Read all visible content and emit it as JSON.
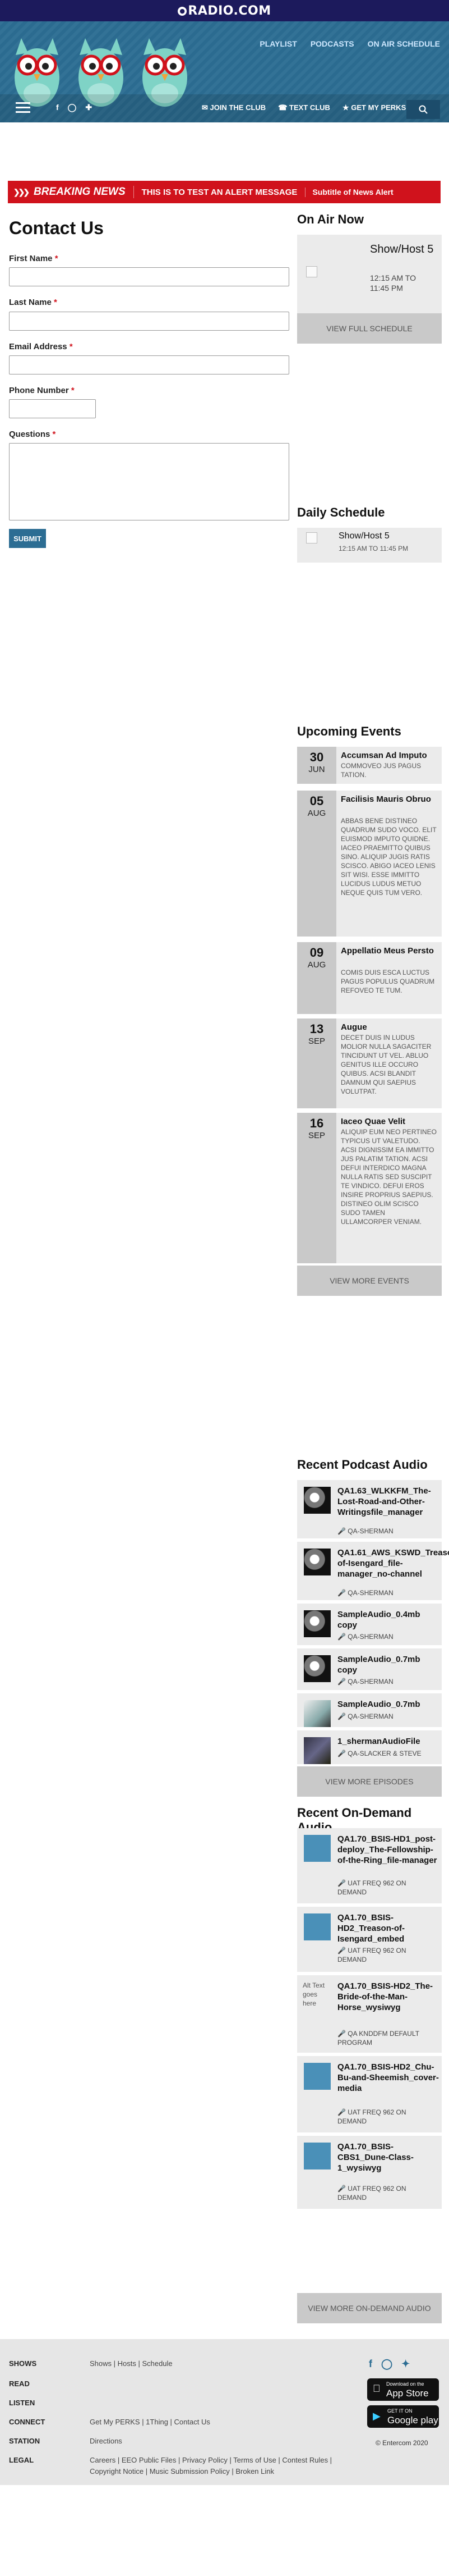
{
  "brand": {
    "logo": "RADIO.COM",
    "logo_mark": "●"
  },
  "header": {
    "nav_top": [
      "PLAYLIST",
      "PODCASTS",
      "ON AIR SCHEDULE"
    ],
    "perks": [
      "JOIN THE CLUB",
      "TEXT CLUB",
      "GET MY PERKS"
    ]
  },
  "alert": {
    "label": "BREAKING NEWS",
    "message": "THIS IS TO TEST AN ALERT MESSAGE",
    "subtitle": "Subtitle of News Alert"
  },
  "form": {
    "title": "Contact Us",
    "fields": [
      {
        "label": "First Name",
        "required": "*"
      },
      {
        "label": "Last Name",
        "required": "*"
      },
      {
        "label": "Email Address",
        "required": "*"
      },
      {
        "label": "Phone Number",
        "required": "*"
      },
      {
        "label": "Questions",
        "required": "*"
      }
    ],
    "submit": "SUBMIT"
  },
  "on_air": {
    "heading": "On Air Now",
    "show": "Show/Host 5",
    "time": "12:15 AM TO 11:45 PM",
    "button": "VIEW FULL SCHEDULE"
  },
  "daily": {
    "heading": "Daily Schedule",
    "show": "Show/Host 5",
    "time": "12:15 AM TO 11:45 PM"
  },
  "events": {
    "heading": "Upcoming Events",
    "items": [
      {
        "day": "30",
        "month": "JUN",
        "title": "Accumsan Ad Imputo",
        "desc": "COMMOVEO JUS PAGUS TATION."
      },
      {
        "day": "05",
        "month": "AUG",
        "title": "Facilisis Mauris Obruo",
        "desc": "ABBAS BENE DISTINEO QUADRUM SUDO VOCO. ELIT EUISMOD IMPUTO QUIDNE. IACEO PRAEMITTO QUIBUS SINO. ALIQUIP JUGIS RATIS SCISCO. ABIGO IACEO LENIS SIT WISI. ESSE IMMITTO LUCIDUS LUDUS METUO NEQUE QUIS TUM VERO."
      },
      {
        "day": "09",
        "month": "AUG",
        "title": "Appellatio Meus Persto",
        "desc": "COMIS DUIS ESCA LUCTUS PAGUS POPULUS QUADRUM REFOVEO TE TUM."
      },
      {
        "day": "13",
        "month": "SEP",
        "title": "Augue",
        "desc": "DECET DUIS IN LUDUS MOLIOR NULLA SAGACITER TINCIDUNT UT VEL. ABLUO GENITUS ILLE OCCURO QUIBUS. ACSI BLANDIT DAMNUM QUI SAEPIUS VOLUTPAT."
      },
      {
        "day": "16",
        "month": "SEP",
        "title": "Iaceo Quae Velit",
        "desc": "ALIQUIP EUM NEO PERTINEO TYPICUS UT VALETUDO. ACSI DIGNISSIM EA IMMITTO JUS PALATIM TATION. ACSI DEFUI INTERDICO MAGNA NULLA RATIS SED SUSCIPIT TE VINDICO. DEFUI EROS INSIRE PROPRIUS SAEPIUS. DISTINEO OLIM SCISCO SUDO TAMEN ULLAMCORPER VENIAM."
      }
    ],
    "button": "VIEW MORE EVENTS"
  },
  "podcasts": {
    "heading": "Recent Podcast Audio",
    "items": [
      {
        "title": "QA1.63_WLKKFM_The-Lost-Road-and-Other-Writingsfile_manager",
        "author": "QA-SHERMAN"
      },
      {
        "title": "QA1.61_AWS_KSWD_Treason-of-Isengard_file-manager_no-channel",
        "author": "QA-SHERMAN"
      },
      {
        "title": "SampleAudio_0.4mb copy",
        "author": "QA-SHERMAN"
      },
      {
        "title": "SampleAudio_0.7mb copy",
        "author": "QA-SHERMAN"
      },
      {
        "title": "SampleAudio_0.7mb",
        "author": "QA-SHERMAN"
      },
      {
        "title": "1_shermanAudioFile",
        "author": "QA-SLACKER & STEVE"
      }
    ],
    "button": "VIEW MORE EPISODES"
  },
  "ondemand": {
    "heading": "Recent On-Demand Audio",
    "items": [
      {
        "title": "QA1.70_BSIS-HD1_post-deploy_The-Fellowship-of-the-Ring_file-manager",
        "author": "UAT FREQ 962 ON DEMAND"
      },
      {
        "title": "QA1.70_BSIS-HD2_Treason-of-Isengard_embed",
        "author": "UAT FREQ 962 ON DEMAND"
      },
      {
        "title": "QA1.70_BSIS-HD2_The-Bride-of-the-Man-Horse_wysiwyg",
        "author": "QA KNDDFM DEFAULT PROGRAM",
        "alt": "Alt Text goes here"
      },
      {
        "title": "QA1.70_BSIS-HD2_Chu-Bu-and-Sheemish_cover-media",
        "author": "UAT FREQ 962 ON DEMAND"
      },
      {
        "title": "QA1.70_BSIS-CBS1_Dune-Class-1_wysiwyg",
        "author": "UAT FREQ 962 ON DEMAND"
      }
    ],
    "button": "VIEW MORE ON-DEMAND AUDIO"
  },
  "footer": {
    "rows": [
      {
        "label": "SHOWS",
        "links": "Shows | Hosts | Schedule"
      },
      {
        "label": "READ",
        "links": ""
      },
      {
        "label": "LISTEN",
        "links": ""
      },
      {
        "label": "CONNECT",
        "links": "Get My PERKS | 1Thing | Contact Us"
      },
      {
        "label": "STATION",
        "links": "Directions"
      },
      {
        "label": "LEGAL",
        "links": "Careers | EEO Public Files | Privacy Policy | Terms of Use | Contest Rules | Copyright Notice | Music Submission Policy | Broken Link"
      }
    ],
    "appstore_small": "Download on the",
    "appstore": "App Store",
    "googleplay_small": "GET IT ON",
    "googleplay": "Google play",
    "copyright": "© Entercom 2020"
  },
  "colors": {
    "topbar": "#1c1a5c",
    "header": "#2c6d93",
    "alert": "#d0121c",
    "sidebar_bg": "#ebebeb"
  }
}
